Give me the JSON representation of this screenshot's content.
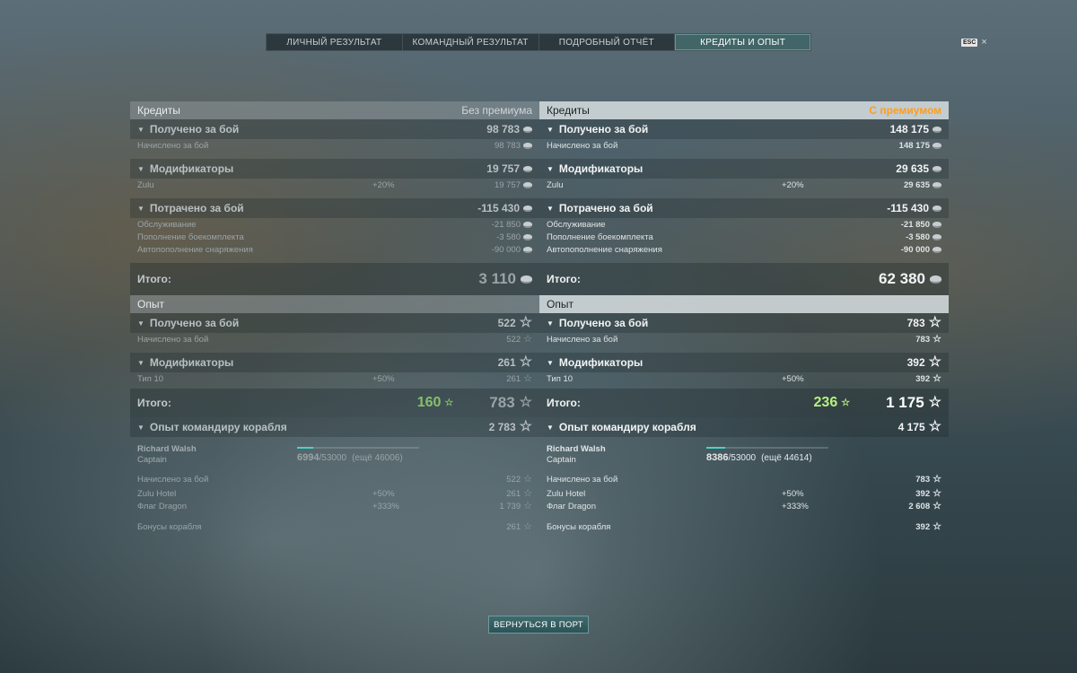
{
  "tabs": [
    "ЛИЧНЫЙ РЕЗУЛЬТАТ",
    "КОМАНДНЫЙ РЕЗУЛЬТАТ",
    "ПОДРОБНЫЙ ОТЧЁТ",
    "КРЕДИТЫ И ОПЫТ"
  ],
  "active_tab": "КРЕДИТЫ И ОПЫТ",
  "esc": {
    "key": "ESC",
    "close": "×"
  },
  "left": {
    "credits_header": "Кредиты",
    "credits_subheader": "Без премиума",
    "earned": {
      "label": "Получено за бой",
      "value": "98 783",
      "rows": [
        {
          "label": "Начислено за бой",
          "value": "98 783"
        }
      ]
    },
    "modifiers": {
      "label": "Модификаторы",
      "value": "19 757",
      "rows": [
        {
          "label": "Zulu",
          "pct": "+20%",
          "value": "19 757"
        }
      ]
    },
    "spent": {
      "label": "Потрачено за бой",
      "value": "-115 430",
      "rows": [
        {
          "label": "Обслуживание",
          "value": "-21 850"
        },
        {
          "label": "Пополнение боекомплекта",
          "value": "-3 580"
        },
        {
          "label": "Автопополнение снаряжения",
          "value": "-90 000"
        }
      ]
    },
    "total_label": "Итого:",
    "credits_total": "3 110",
    "xp_header": "Опыт",
    "xp_earned": {
      "label": "Получено за бой",
      "value": "522",
      "rows": [
        {
          "label": "Начислено за бой",
          "value": "522"
        }
      ]
    },
    "xp_modifiers": {
      "label": "Модификаторы",
      "value": "261",
      "rows": [
        {
          "label": "Тип 10",
          "pct": "+50%",
          "value": "261"
        }
      ]
    },
    "xp_total_free": "160",
    "xp_total": "783",
    "commander": {
      "label": "Опыт командиру корабля",
      "value": "2 783",
      "name": "Richard Walsh",
      "rank": "Captain",
      "current": "6994",
      "max": "/53000",
      "remaining": "(ещё 46006)",
      "progress": 0.132,
      "rows": [
        {
          "label": "Начислено за бой",
          "value": "522"
        }
      ],
      "rows2": [
        {
          "label": "Zulu Hotel",
          "pct": "+50%",
          "value": "261"
        },
        {
          "label": "Флаг Dragon",
          "pct": "+333%",
          "value": "1 739"
        }
      ],
      "rows3": [
        {
          "label": "Бонусы корабля",
          "value": "261"
        }
      ]
    }
  },
  "right": {
    "credits_header": "Кредиты",
    "credits_subheader": "С премиумом",
    "earned": {
      "label": "Получено за бой",
      "value": "148 175",
      "rows": [
        {
          "label": "Начислено за бой",
          "value": "148 175"
        }
      ]
    },
    "modifiers": {
      "label": "Модификаторы",
      "value": "29 635",
      "rows": [
        {
          "label": "Zulu",
          "pct": "+20%",
          "value": "29 635"
        }
      ]
    },
    "spent": {
      "label": "Потрачено за бой",
      "value": "-115 430",
      "rows": [
        {
          "label": "Обслуживание",
          "value": "-21 850"
        },
        {
          "label": "Пополнение боекомплекта",
          "value": "-3 580"
        },
        {
          "label": "Автопополнение снаряжения",
          "value": "-90 000"
        }
      ]
    },
    "total_label": "Итого:",
    "credits_total": "62 380",
    "xp_header": "Опыт",
    "xp_earned": {
      "label": "Получено за бой",
      "value": "783",
      "rows": [
        {
          "label": "Начислено за бой",
          "value": "783"
        }
      ]
    },
    "xp_modifiers": {
      "label": "Модификаторы",
      "value": "392",
      "rows": [
        {
          "label": "Тип 10",
          "pct": "+50%",
          "value": "392"
        }
      ]
    },
    "xp_total_free": "236",
    "xp_total": "1 175",
    "commander": {
      "label": "Опыт командиру корабля",
      "value": "4 175",
      "name": "Richard Walsh",
      "rank": "Captain",
      "current": "8386",
      "max": "/53000",
      "remaining": "(ещё 44614)",
      "progress": 0.158,
      "rows": [
        {
          "label": "Начислено за бой",
          "value": "783"
        }
      ],
      "rows2": [
        {
          "label": "Zulu Hotel",
          "pct": "+50%",
          "value": "392"
        },
        {
          "label": "Флаг Dragon",
          "pct": "+333%",
          "value": "2 608"
        }
      ],
      "rows3": [
        {
          "label": "Бонусы корабля",
          "value": "392"
        }
      ]
    }
  },
  "back_button": "ВЕРНУТЬСЯ В ПОРТ",
  "icons": {
    "credits": "credits-coin-icon",
    "xp": "xp-star-icon",
    "collapse": "chevron-down-icon"
  },
  "colors": {
    "premium": "#ff9d1b",
    "free_xp": "#b6f07f",
    "progress": "#46d3c8"
  }
}
